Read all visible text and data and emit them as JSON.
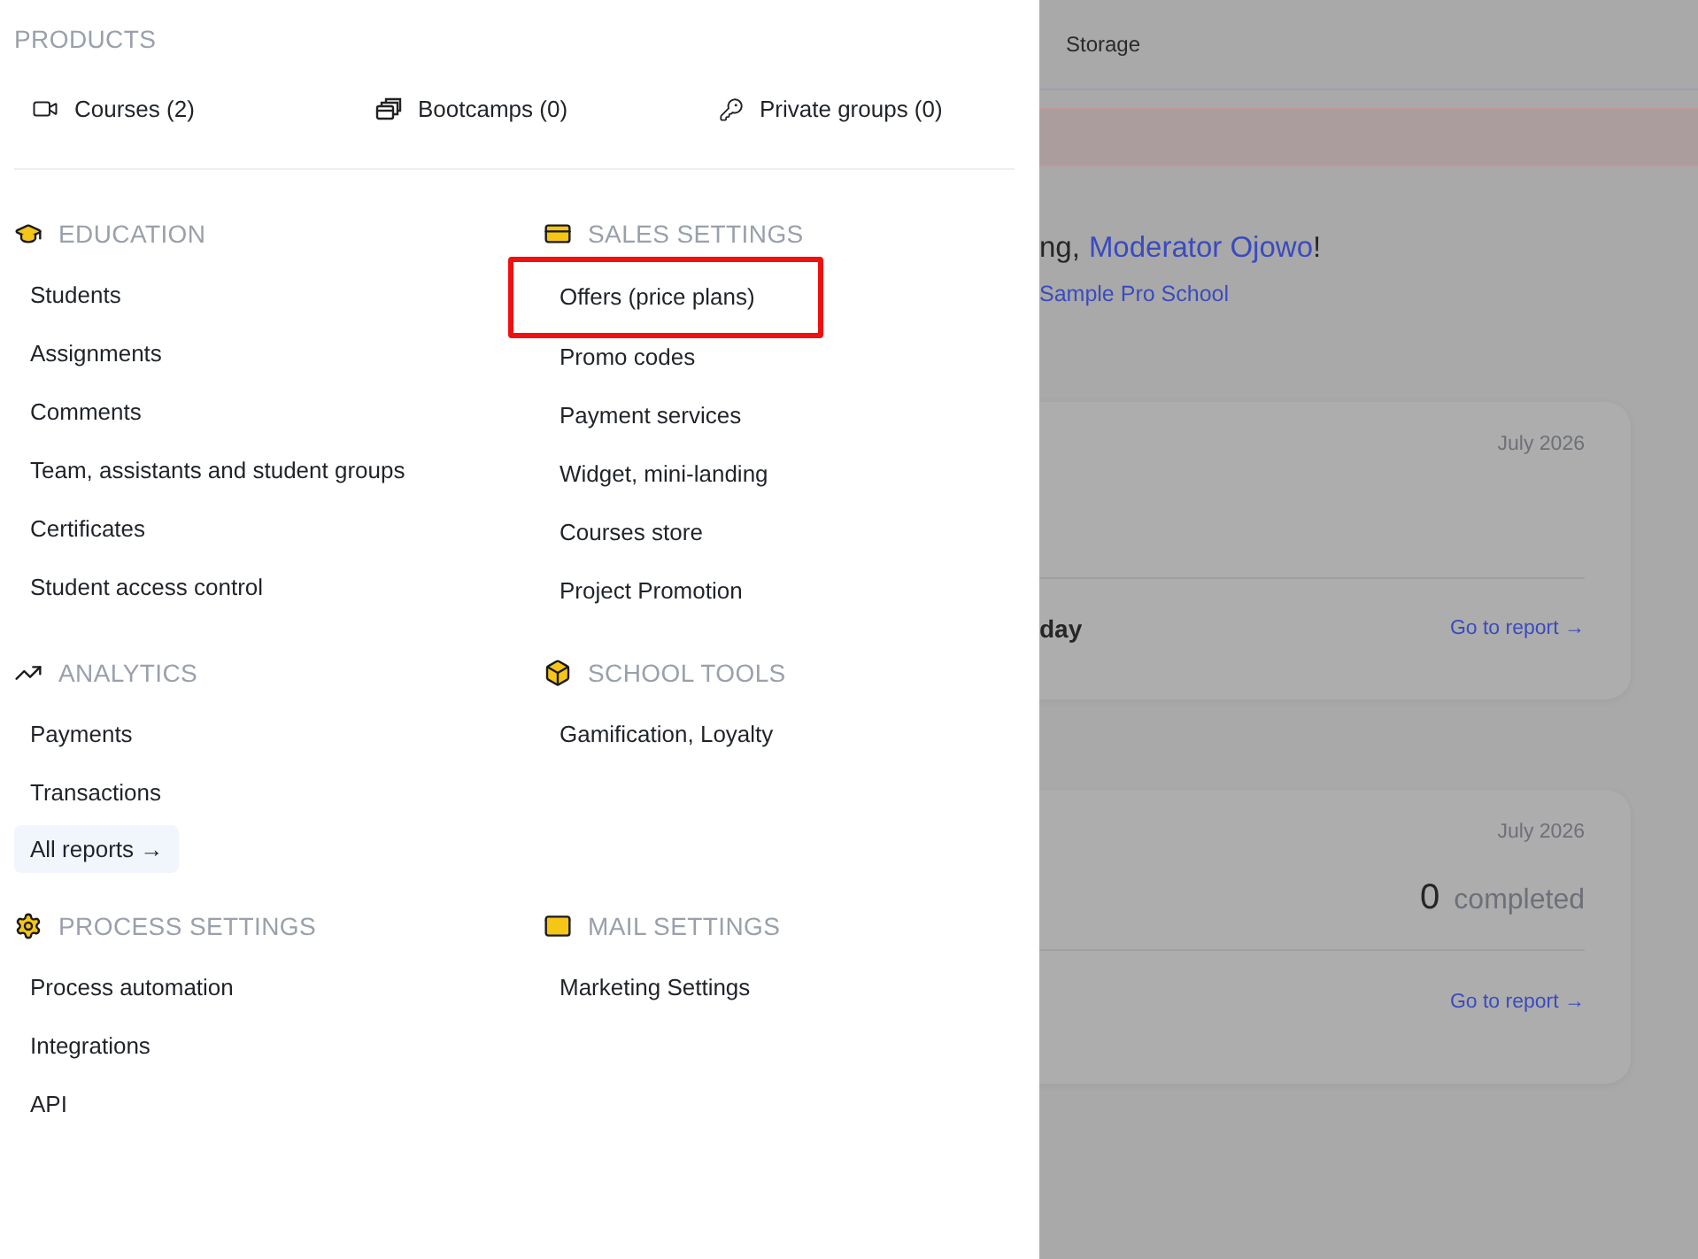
{
  "menu": {
    "products": {
      "title": "PRODUCTS",
      "items": [
        {
          "kind": "video",
          "label": "Courses (2)"
        },
        {
          "kind": "stack",
          "label": "Bootcamps (0)"
        },
        {
          "kind": "key",
          "label": "Private groups (0)"
        }
      ]
    },
    "sections": [
      {
        "title": "EDUCATION",
        "items": [
          {
            "kind": "link",
            "label": "Students",
            "highlighted": false
          },
          {
            "kind": "link",
            "label": "Assignments",
            "highlighted": false
          },
          {
            "kind": "link",
            "label": "Comments",
            "highlighted": false
          },
          {
            "kind": "link",
            "label": "Team, assistants and student groups",
            "highlighted": false
          },
          {
            "kind": "link",
            "label": "Certificates",
            "highlighted": false
          },
          {
            "kind": "link",
            "label": "Student access control",
            "highlighted": false
          }
        ]
      },
      {
        "title": "SALES SETTINGS",
        "items": [
          {
            "kind": "link",
            "label": "Offers (price plans)",
            "highlighted": true
          },
          {
            "kind": "link",
            "label": "Promo codes",
            "highlighted": false
          },
          {
            "kind": "link",
            "label": "Payment services",
            "highlighted": false
          },
          {
            "kind": "link",
            "label": "Widget, mini-landing",
            "highlighted": false
          },
          {
            "kind": "link",
            "label": "Courses store",
            "highlighted": false
          },
          {
            "kind": "link",
            "label": "Project Promotion",
            "highlighted": false
          }
        ]
      },
      {
        "title": "ANALYTICS",
        "items": [
          {
            "kind": "link",
            "label": "Payments",
            "highlighted": false
          },
          {
            "kind": "link",
            "label": "Transactions",
            "highlighted": false
          },
          {
            "kind": "button",
            "label": "All reports →",
            "highlighted": false
          }
        ]
      },
      {
        "title": "SCHOOL TOOLS",
        "items": [
          {
            "kind": "link",
            "label": "Gamification, Loyalty",
            "highlighted": false
          }
        ]
      },
      {
        "title": "PROCESS SETTINGS",
        "items": [
          {
            "kind": "link",
            "label": "Process automation",
            "highlighted": false
          },
          {
            "kind": "link",
            "label": "Integrations",
            "highlighted": false
          },
          {
            "kind": "link",
            "label": "API",
            "highlighted": false
          }
        ]
      },
      {
        "title": "MAIL SETTINGS",
        "items": [
          {
            "kind": "link",
            "label": "Marketing Settings",
            "highlighted": false
          }
        ]
      }
    ]
  },
  "page": {
    "top_tab": "Storage",
    "greeting": {
      "prefix": "ng,",
      "name": "Moderator Ojowo",
      "suffix": "!"
    },
    "school": "Sample Pro School",
    "cards": [
      {
        "kind": "day",
        "date": "July 2026",
        "label": "day",
        "link": "Go to report →"
      },
      {
        "kind": "count",
        "date": "July 2026",
        "count": "0",
        "count_label": "completed",
        "link": "Go to report →"
      }
    ]
  }
}
